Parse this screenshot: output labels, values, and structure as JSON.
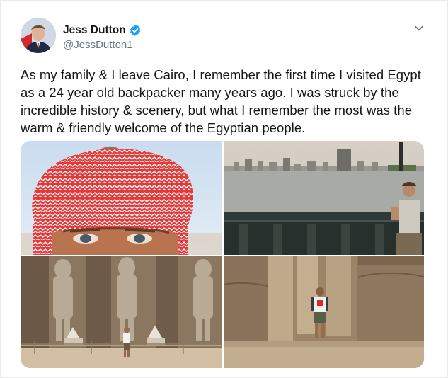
{
  "tweet": {
    "author": {
      "display_name": "Jess Dutton",
      "handle": "@JessDutton1",
      "verified": true
    },
    "text": "As my family & I leave Cairo, I remember the first time I visited Egypt as a 24 year old backpacker many years ago. I was struck by the incredible history & scenery, but what I remember the most was the warm & friendly welcome of the Egyptian people.",
    "menu_icon": "chevron-down-icon",
    "photos": [
      {
        "subject": "close-up-turban-portrait"
      },
      {
        "subject": "nile-river-cairo-skyline"
      },
      {
        "subject": "temple-pharaoh-statues"
      },
      {
        "subject": "temple-columns-backpacker"
      }
    ]
  },
  "colors": {
    "verified_blue": "#1da1f2",
    "secondary_text": "#657786",
    "primary_text": "#14171a",
    "border": "#e6ecf0"
  }
}
